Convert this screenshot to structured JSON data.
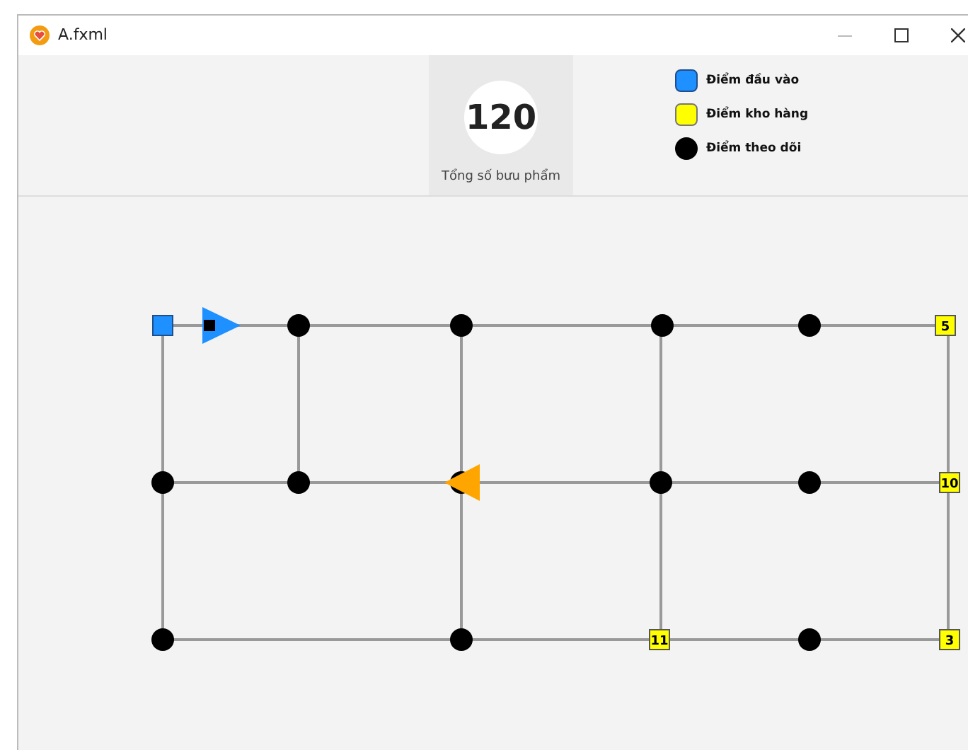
{
  "window": {
    "title": "A.fxml"
  },
  "counter": {
    "value": "120",
    "caption": "Tổng số bưu phẩm"
  },
  "legend": [
    {
      "kind": "input",
      "label": "Điểm đầu vào"
    },
    {
      "kind": "warehouse",
      "label": "Điểm kho hàng"
    },
    {
      "kind": "tracking",
      "label": "Điểm theo dõi"
    }
  ],
  "nodes": [
    {
      "kind": "input"
    },
    {
      "kind": "tracking"
    },
    {
      "kind": "tracking"
    },
    {
      "kind": "tracking"
    },
    {
      "kind": "tracking"
    },
    {
      "kind": "warehouse",
      "label": "5"
    },
    {
      "kind": "tracking"
    },
    {
      "kind": "tracking"
    },
    {
      "kind": "tracking"
    },
    {
      "kind": "tracking"
    },
    {
      "kind": "tracking"
    },
    {
      "kind": "warehouse",
      "label": "10"
    },
    {
      "kind": "tracking"
    },
    {
      "kind": "tracking"
    },
    {
      "kind": "warehouse",
      "label": "11"
    },
    {
      "kind": "tracking"
    },
    {
      "kind": "warehouse",
      "label": "3"
    }
  ],
  "vehicles": [
    {
      "kind": "rightward",
      "color": "#1e90ff",
      "loaded": true
    },
    {
      "kind": "leftward",
      "color": "#ffa500",
      "loaded": false
    }
  ]
}
